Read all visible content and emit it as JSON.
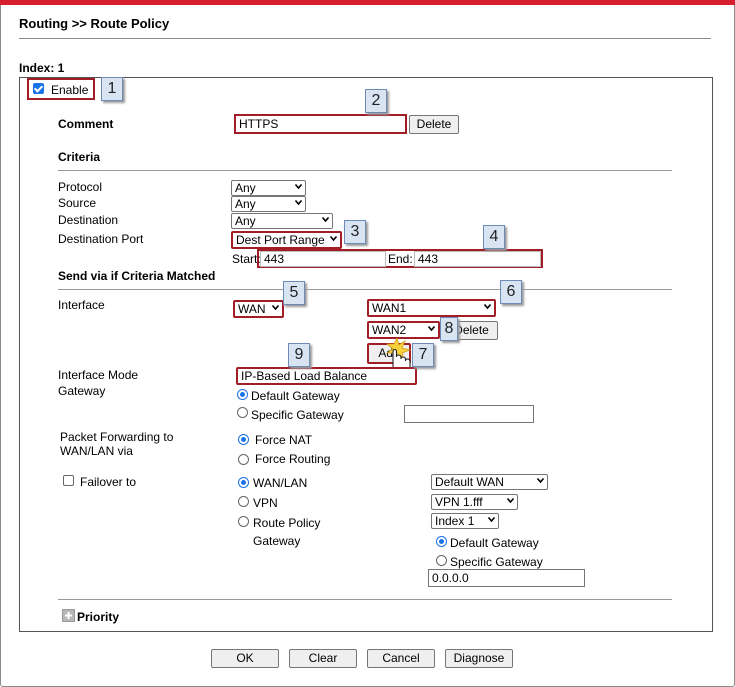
{
  "breadcrumb": "Routing >> Route Policy",
  "index_label": "Index: 1",
  "enable": {
    "label": "Enable",
    "checked": true
  },
  "comment": {
    "label": "Comment",
    "value": "HTTPS",
    "delete_label": "Delete"
  },
  "criteria": {
    "heading": "Criteria",
    "protocol": {
      "label": "Protocol",
      "value": "Any"
    },
    "source": {
      "label": "Source",
      "value": "Any"
    },
    "destination": {
      "label": "Destination",
      "value": "Any"
    },
    "dest_port": {
      "label": "Destination Port",
      "value": "Dest Port Range",
      "start_label": "Start:",
      "start_value": "443",
      "end_label": "End:",
      "end_value": "443"
    }
  },
  "send_via": {
    "heading": "Send via if Criteria Matched",
    "interface": {
      "label": "Interface",
      "value": "WAN",
      "lb1": "WAN1",
      "lb2": "WAN2",
      "delete_label": "Delete",
      "add_label": "Add"
    },
    "interface_mode": {
      "label": "Interface Mode",
      "value": "IP-Based Load Balance"
    },
    "gateway": {
      "label": "Gateway",
      "default_label": "Default Gateway",
      "specific_label": "Specific Gateway",
      "specific_value": ""
    },
    "packet_forwarding": {
      "label_line1": "Packet Forwarding to",
      "label_line2": "WAN/LAN via",
      "force_nat": "Force NAT",
      "force_routing": "Force Routing"
    },
    "failover": {
      "label": "Failover to",
      "checked": false,
      "wan_lan": "WAN/LAN",
      "vpn": "VPN",
      "route_policy": "Route Policy",
      "gateway_label": "Gateway",
      "wan_value": "Default WAN",
      "vpn_value": "VPN 1.fff",
      "index_value": "Index 1",
      "default_gateway": "Default Gateway",
      "specific_gateway": "Specific Gateway",
      "gateway_ip": "0.0.0.0"
    }
  },
  "priority": {
    "label": "Priority"
  },
  "buttons": {
    "ok": "OK",
    "clear": "Clear",
    "cancel": "Cancel",
    "diagnose": "Diagnose"
  },
  "callouts": [
    "1",
    "2",
    "3",
    "4",
    "5",
    "6",
    "7",
    "8",
    "9"
  ],
  "colors": {
    "highlight": "#a31d27",
    "accent": "#1a73e8",
    "top_bar": "#d61f2c"
  }
}
